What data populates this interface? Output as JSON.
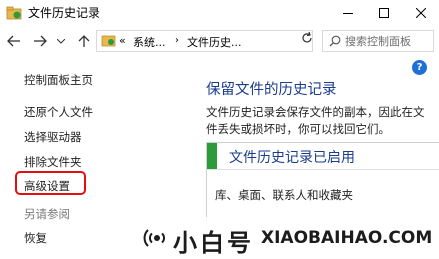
{
  "window": {
    "title": "文件历史记录"
  },
  "navbar": {
    "breadcrumbs": [
      "«",
      "系统...",
      "›",
      "文件历史..."
    ],
    "search_placeholder": "搜索控制面板"
  },
  "help": {
    "label": "?"
  },
  "left_pane": {
    "home_link": "控制面板主页",
    "links": [
      "还原个人文件",
      "选择驱动器",
      "排除文件夹",
      "高级设置"
    ],
    "see_also_label": "另请参阅",
    "see_also_links": [
      "恢复"
    ]
  },
  "main": {
    "heading": "保留文件的历史记录",
    "description": "文件历史记录会保存文件的副本，因此在文件丢失或损坏时，你可以找回它们。",
    "status_panel": {
      "title": "文件历史记录已启用",
      "item": "库、桌面、联系人和收藏夹"
    }
  },
  "watermark": {
    "cn": "小白号",
    "en": "XIAOBAIHAO.COM"
  },
  "colors": {
    "accent_blue": "#1b3c8c",
    "status_green": "#2c9b3c",
    "highlight_red": "#e01010"
  }
}
